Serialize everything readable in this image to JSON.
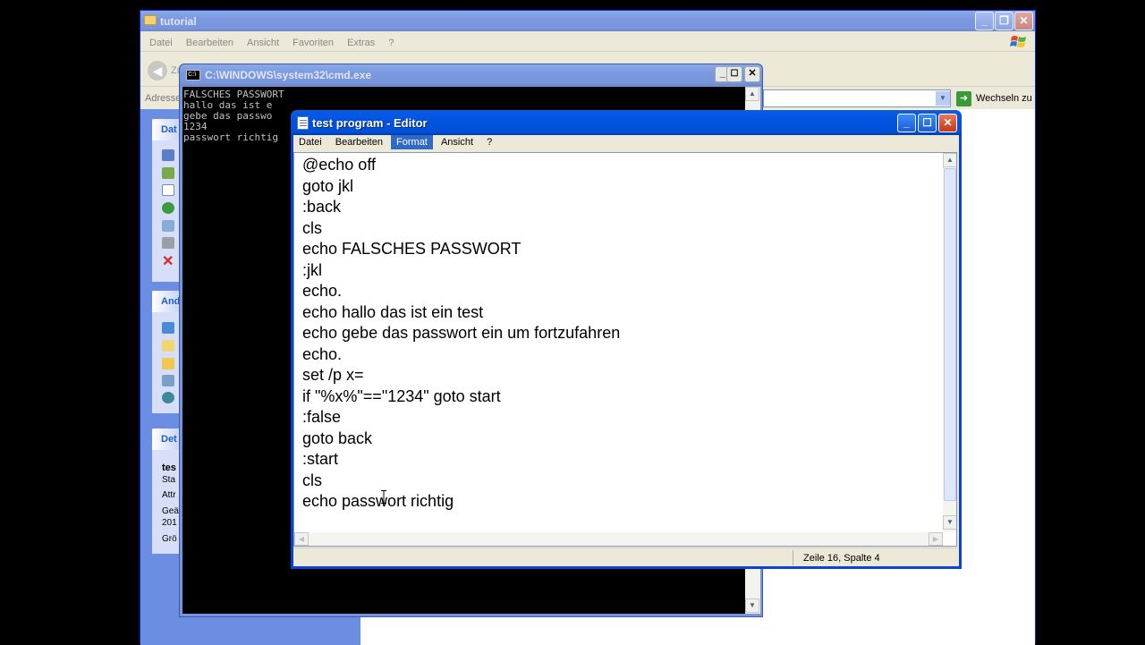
{
  "explorer": {
    "title": "tutorial",
    "menu": [
      "Datei",
      "Bearbeiten",
      "Ansicht",
      "Favoriten",
      "Extras",
      "?"
    ],
    "back_label": "Zu",
    "address_label": "Adresse",
    "go_label": "Wechseln zu",
    "panels": [
      {
        "head": "Dat"
      },
      {
        "head": "And"
      },
      {
        "head": "Det"
      }
    ],
    "details": [
      "tes",
      "Sta",
      "Attr",
      "Geä",
      "201",
      "Grö"
    ]
  },
  "cmd": {
    "title": "C:\\WINDOWS\\system32\\cmd.exe",
    "lines": [
      "FALSCHES PASSWORT",
      "",
      "hallo das ist e",
      "gebe das passwo",
      "",
      "1234",
      "passwort richtig"
    ]
  },
  "editor": {
    "title": "test program - Editor",
    "menu": [
      {
        "label": "Datei",
        "active": false
      },
      {
        "label": "Bearbeiten",
        "active": false
      },
      {
        "label": "Format",
        "active": true
      },
      {
        "label": "Ansicht",
        "active": false
      },
      {
        "label": "?",
        "active": false
      }
    ],
    "lines": [
      "@echo off",
      "goto jkl",
      ":back",
      "cls",
      "echo FALSCHES PASSWORT",
      ":jkl",
      "echo.",
      "echo hallo das ist ein test",
      "echo gebe das passwort ein um fortzufahren",
      "echo.",
      "set /p x=",
      "if \"%x%\"==\"1234\" goto start",
      ":false",
      "goto back",
      ":start",
      "cls",
      "echo passwort richtig"
    ],
    "status": "Zeile 16, Spalte 4"
  },
  "colors": {
    "xp_blue": "#0053e1",
    "explorer_sidebar": "#6c8ee2",
    "selection": "#316ac5"
  }
}
